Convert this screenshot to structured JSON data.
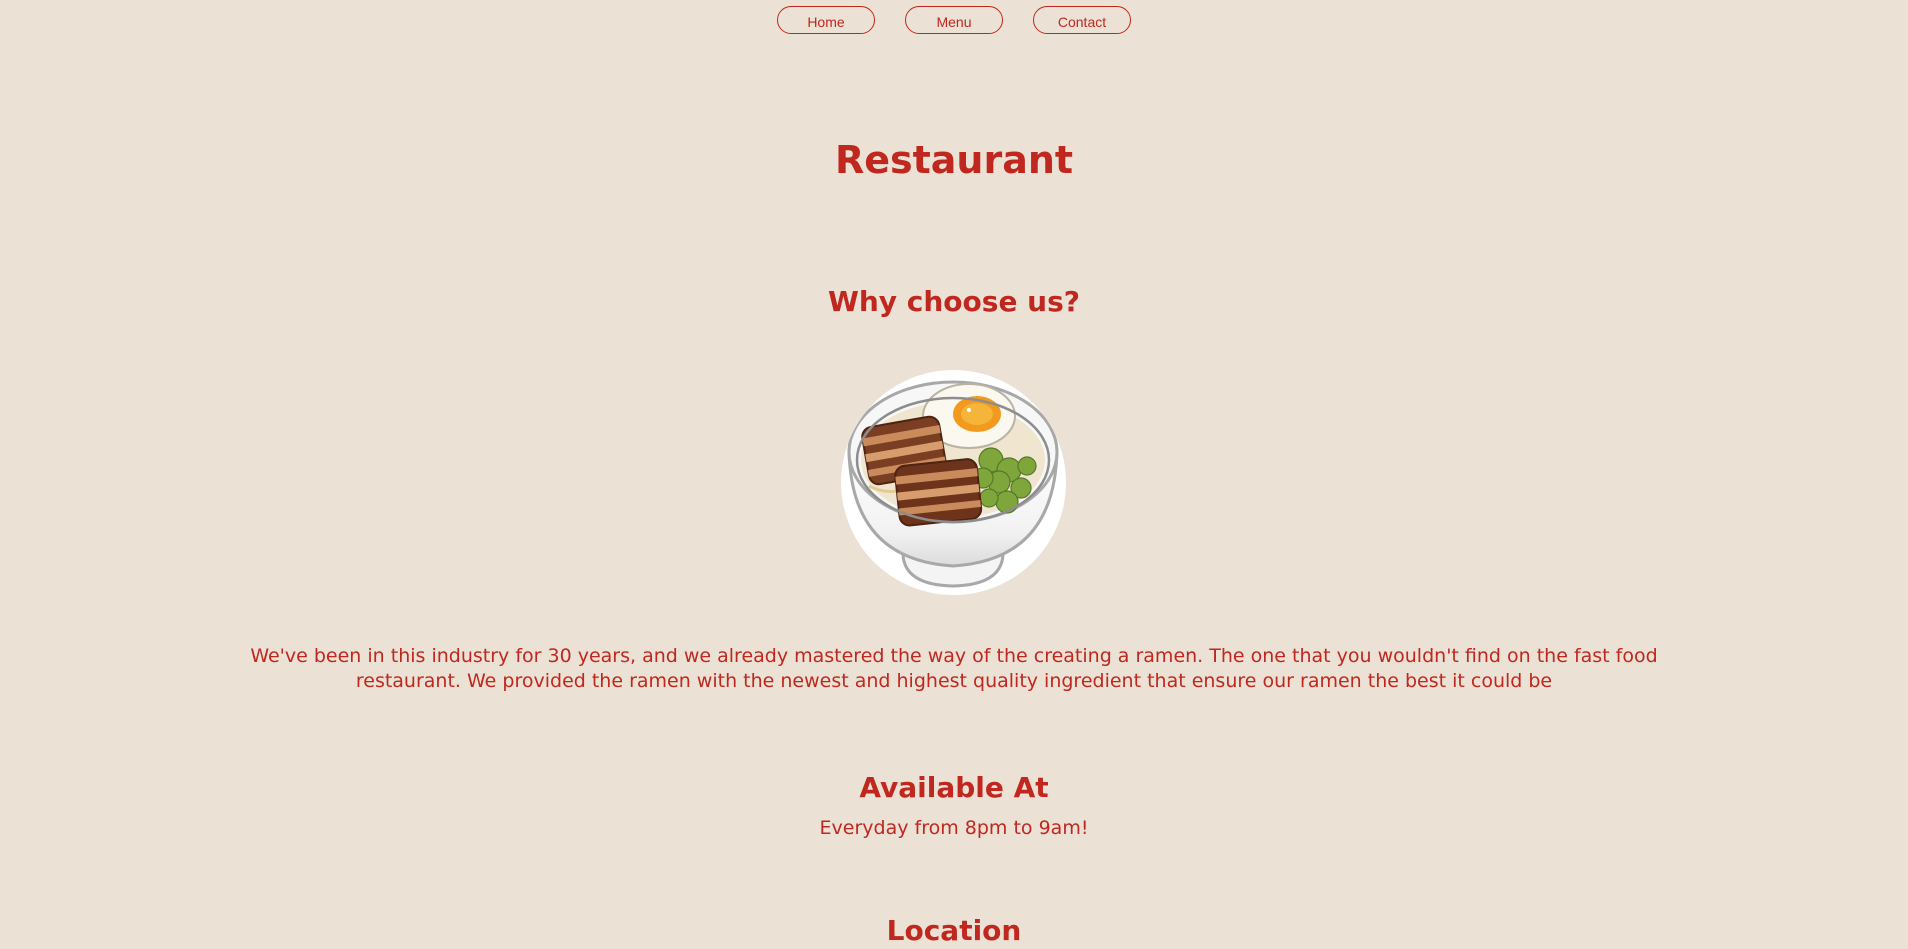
{
  "nav": {
    "items": [
      {
        "label": "Home"
      },
      {
        "label": "Menu"
      },
      {
        "label": "Contact"
      }
    ]
  },
  "hero": {
    "title": "Restaurant"
  },
  "why": {
    "heading": "Why choose us?",
    "image_icon": "ramen-bowl-icon",
    "description": "We've been in this industry for 30 years, and we already mastered the way of the creating a ramen. The one that you wouldn't find on the fast food restaurant. We provided the ramen with the newest and highest quality ingredient that ensure our ramen the best it could be"
  },
  "availability": {
    "heading": "Available At",
    "hours": "Everyday from 8pm to 9am!"
  },
  "location": {
    "heading": "Location"
  },
  "colors": {
    "background": "#ebe1d4",
    "accent": "#c0281f"
  }
}
